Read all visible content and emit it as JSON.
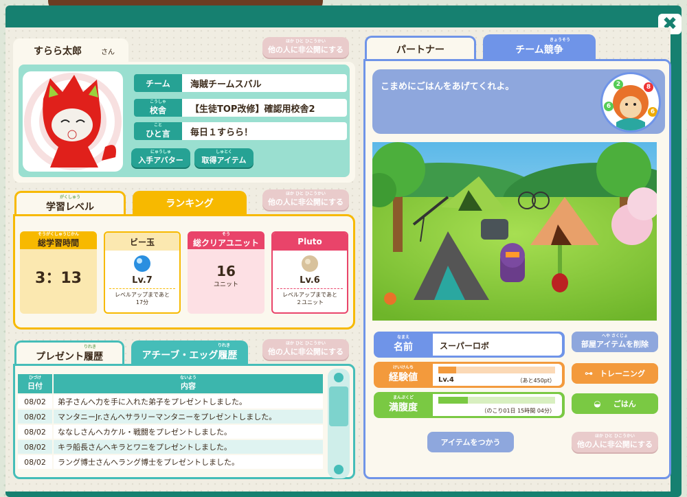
{
  "profile": {
    "name": "すらら太郎",
    "honorific": "さん",
    "private_btn": "他の人に非公開にする",
    "private_ruby": "ほか ひと ひこうかい",
    "team_label": "チーム",
    "team_value": "海賊チームスバル",
    "school_label": "校舎",
    "school_ruby": "こうしゃ",
    "school_value": "【生徒TOP改修】確認用校舎2",
    "word_label": "ひと言",
    "word_ruby": "こと",
    "word_value": "毎日１すらら！",
    "avatar_btn": "入手アバター",
    "avatar_ruby": "にゅうしゅ",
    "item_btn": "取得アイテム",
    "item_ruby": "しゅとく"
  },
  "level": {
    "tab_learning": "学習レベル",
    "tab_learning_ruby": "がくしゅう",
    "tab_ranking": "ランキング",
    "private_btn": "他の人に非公開にする",
    "private_ruby": "ほか ひと ひこうかい",
    "cards": [
      {
        "title": "総学習時間",
        "ruby": "そうがくしゅうじかん",
        "value": "3：13"
      },
      {
        "title": "ビー玉",
        "ruby": "",
        "level": "Lv.7",
        "note": "レベルアップまであと",
        "note2": "17分"
      },
      {
        "title": "総クリアユニット",
        "ruby": "そう",
        "value": "16",
        "unit": "ユニット"
      },
      {
        "title": "Pluto",
        "ruby": "",
        "level": "Lv.6",
        "note": "レベルアップまであと",
        "note2": "２ユニット"
      }
    ]
  },
  "history": {
    "tab_present": "プレゼント履歴",
    "tab_present_ruby": "りれき",
    "tab_achieve": "アチーブ・エッグ履歴",
    "tab_achieve_ruby": "りれき",
    "private_btn": "他の人に非公開にする",
    "private_ruby": "ほか ひと ひこうかい",
    "col_date": "日付",
    "col_date_ruby": "ひづけ",
    "col_content": "内容",
    "col_content_ruby": "ないよう",
    "rows": [
      {
        "date": "08/02",
        "text": "弟子さんへ力を手に入れた弟子をプレゼントしました。"
      },
      {
        "date": "08/02",
        "text": "マンタニーJr.さんへサラリーマンタニーをプレゼントしました。"
      },
      {
        "date": "08/02",
        "text": "ななしさんへカケル・戦闘をプレゼントしました。"
      },
      {
        "date": "08/02",
        "text": "キラ船長さんへキラとワニをプレゼントしました。"
      },
      {
        "date": "08/02",
        "text": "ラング博士さんへラング博士をプレゼントしました。"
      }
    ]
  },
  "partner": {
    "tab_partner": "パートナー",
    "tab_team": "チーム競争",
    "tab_team_ruby": "きょうそう",
    "message": "こまめにごはんをあげてくれよ。",
    "name_label": "名前",
    "name_ruby": "なまえ",
    "name_value": "スーパーロボ",
    "remove_btn": "部屋アイテムを削除",
    "remove_ruby": "へや さくじょ",
    "exp_label": "経験値",
    "exp_ruby": "けいけんち",
    "exp_level": "Lv.4",
    "exp_remaining": "（あと450pt）",
    "exp_fill": 0.15,
    "training_btn": "トレーニング",
    "full_label": "満腹度",
    "full_ruby": "まんぷくど",
    "full_remaining": "（のこり01日 15時間 04分）",
    "full_fill": 0.25,
    "food_btn": "ごはん",
    "use_item_btn": "アイテムをつかう",
    "private_btn": "他の人に非公開にする",
    "private_ruby": "ほか ひと ひこうかい",
    "badges": [
      "2",
      "8",
      "6",
      "6"
    ]
  }
}
